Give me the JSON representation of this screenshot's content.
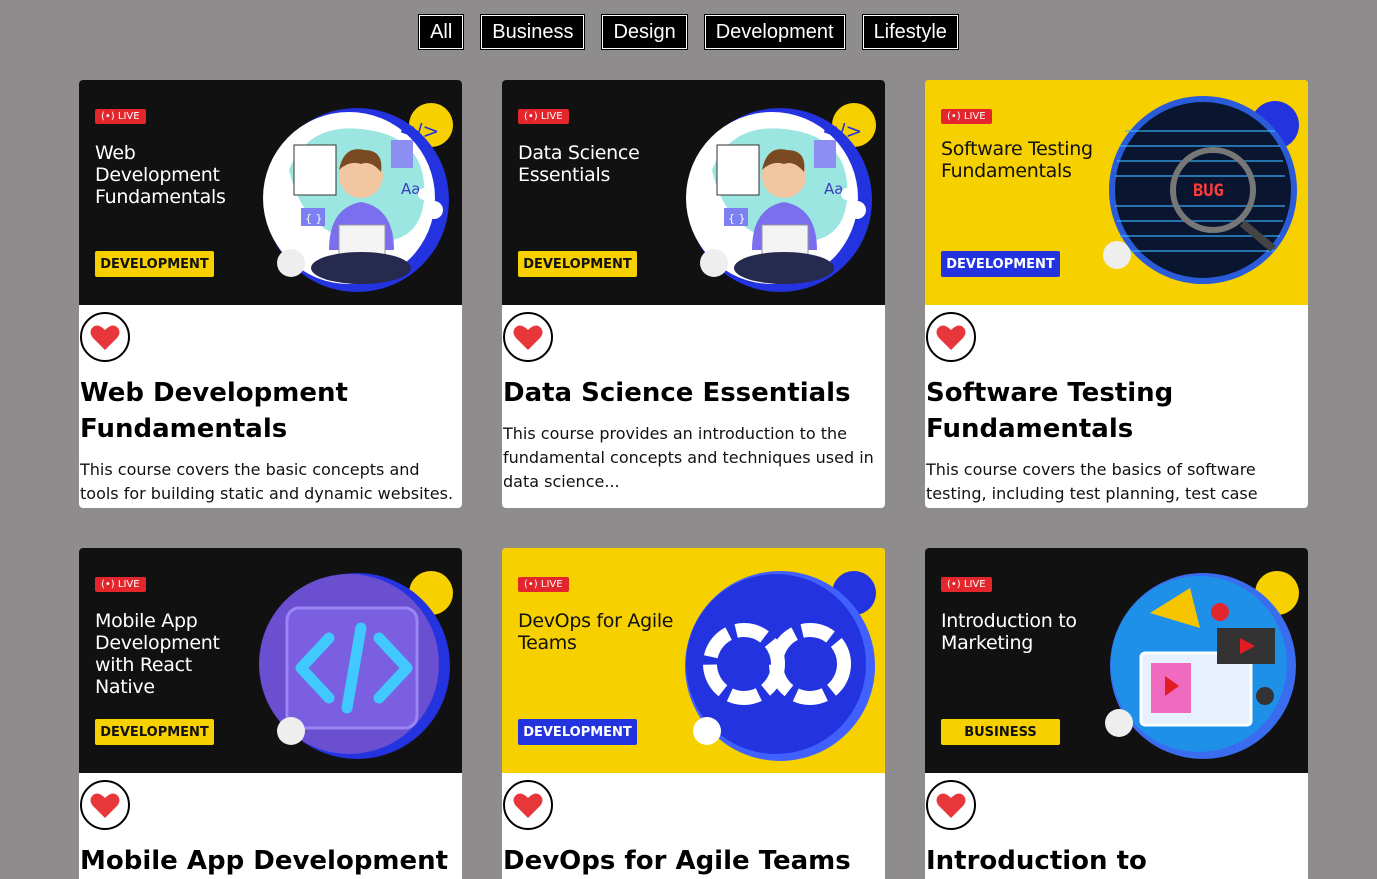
{
  "filters": [
    "All",
    "Business",
    "Design",
    "Development",
    "Lifestyle"
  ],
  "live_label": "LIVE",
  "courses": [
    {
      "banner_title": "Web Development Fundamentals",
      "category": "DEVELOPMENT",
      "title": "Web Development Fundamentals",
      "description": "This course covers the basic concepts and tools for building static and dynamic websites."
    },
    {
      "banner_title": "Data Science Essentials",
      "category": "DEVELOPMENT",
      "title": "Data Science Essentials",
      "description": "This course provides an introduction to the fundamental concepts and techniques used in data science..."
    },
    {
      "banner_title": "Software Testing Fundamentals",
      "category": "DEVELOPMENT",
      "title": "Software Testing Fundamentals",
      "description": "This course covers the basics of software testing, including test planning, test case"
    },
    {
      "banner_title": "Mobile App Development with React Native",
      "category": "DEVELOPMENT",
      "title": "Mobile App Development"
    },
    {
      "banner_title": "DevOps for Agile Teams",
      "category": "DEVELOPMENT",
      "title": "DevOps for Agile Teams"
    },
    {
      "banner_title": "Introduction to Marketing",
      "category": "BUSINESS",
      "title": "Introduction to Marketing"
    }
  ],
  "art_text": {
    "code_icon": "</>",
    "font_icon": "Aa",
    "braces_icon": "{ }",
    "bug_text": "BUG"
  },
  "colors": {
    "background": "#8e8c8c",
    "live_red": "#e3262b",
    "yellow": "#f7d000",
    "blue": "#2433e0",
    "dark": "#111111",
    "heart": "#e8373a"
  }
}
